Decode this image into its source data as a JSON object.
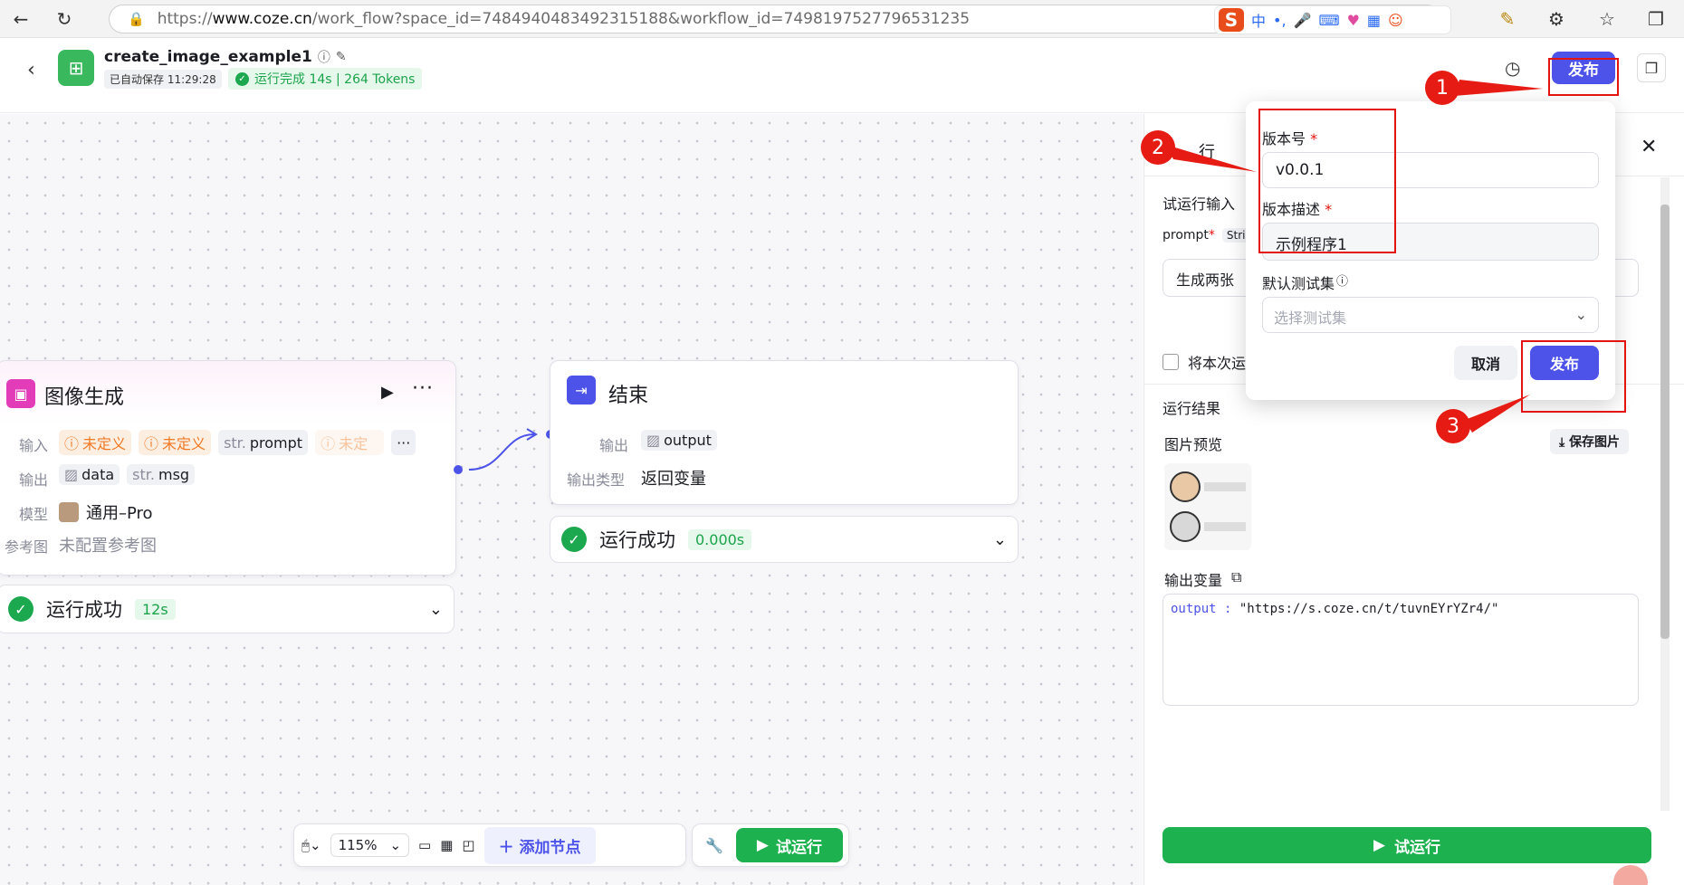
{
  "browser": {
    "url_prefix": "https://",
    "url_host": "www.coze.cn",
    "url_path": "/work_flow?space_id=7484940483492315188&workflow_id=7498197527796531235",
    "ime_label": "中"
  },
  "header": {
    "title": "create_image_example1",
    "autosave": "已自动保存 11:29:28",
    "run_status": "运行完成 14s | 264 Tokens",
    "publish_label": "发布"
  },
  "image_node": {
    "title": "图像生成",
    "input_label": "输入",
    "undefined_1": "未定义",
    "undefined_2": "未定义",
    "prompt_type": "str.",
    "prompt_name": "prompt",
    "undefined_3": "未定",
    "output_label": "输出",
    "out_data": "data",
    "out_msg_type": "str.",
    "out_msg": "msg",
    "model_label": "模型",
    "model_value": "通用–Pro",
    "ref_label": "参考图",
    "ref_value": "未配置参考图",
    "status": "运行成功",
    "time": "12s"
  },
  "end_node": {
    "title": "结束",
    "output_label": "输出",
    "output_value": "output",
    "type_label": "输出类型",
    "type_value": "返回变量",
    "status": "运行成功",
    "time": "0.000s"
  },
  "toolbar": {
    "zoom": "115%",
    "add_node": "添加节点",
    "test_run": "试运行"
  },
  "panel": {
    "title_partial": "行",
    "input_section": "试运行输入",
    "prompt_label": "prompt",
    "prompt_type": "Stri",
    "prompt_value": "生成两张",
    "save_checkbox_label": "将本次运",
    "result_label": "运行结果",
    "preview_label": "图片预览",
    "save_image": "保存图片",
    "output_var_label": "输出变量",
    "output_key": "output",
    "output_value": "\"https://s.coze.cn/t/tuvnEYrYZr4/\"",
    "test_run": "试运行"
  },
  "publish_popover": {
    "version_label": "版本号",
    "version_value": "v0.0.1",
    "desc_label": "版本描述",
    "desc_value": "示例程序1",
    "testset_label": "默认测试集",
    "testset_placeholder": "选择测试集",
    "cancel": "取消",
    "publish": "发布"
  },
  "annotations": [
    "1",
    "2",
    "3"
  ],
  "colors": {
    "accent": "#4d53e8",
    "success": "#1db14f",
    "annotation_red": "#e61b14"
  }
}
